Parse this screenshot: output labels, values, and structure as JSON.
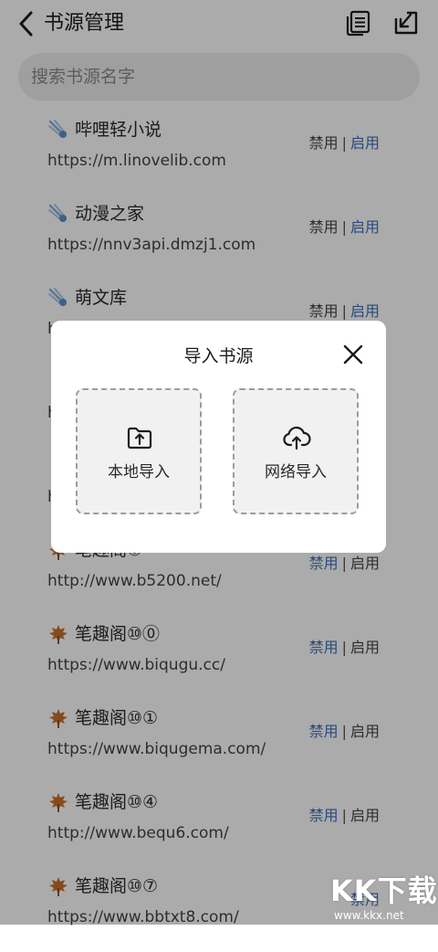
{
  "header": {
    "title": "书源管理",
    "back_icon": "chevron-left-icon",
    "list_icon": "list-icon",
    "export_icon": "arrow-down-left-icon"
  },
  "search": {
    "placeholder": "搜索书源名字"
  },
  "sources": [
    {
      "name": "哔哩轻小说",
      "url": "https://m.linovelib.com",
      "emoji": "comet-icon",
      "disable": "禁用",
      "sep": "|",
      "enable": "启用",
      "enabled": true
    },
    {
      "name": "动漫之家",
      "url": "https://nnv3api.dmzj1.com",
      "emoji": "comet-icon",
      "disable": "禁用",
      "sep": "|",
      "enable": "启用",
      "enabled": true
    },
    {
      "name": "萌文库",
      "url": "h",
      "emoji": "comet-icon",
      "disable": "禁用",
      "sep": "|",
      "enable": "启用",
      "enabled": true
    },
    {
      "name": "",
      "url": "h",
      "emoji": "",
      "disable": "",
      "sep": "",
      "enable": "",
      "enabled": true
    },
    {
      "name": "",
      "url": "h",
      "emoji": "",
      "disable": "",
      "sep": "",
      "enable": "",
      "enabled": true
    },
    {
      "name": "笔趣阁⑥",
      "url": "http://www.b5200.net/",
      "emoji": "leaf-icon",
      "disable": "禁用",
      "sep": "|",
      "enable": "启用",
      "enabled": false
    },
    {
      "name": "笔趣阁⑩⓪",
      "url": "https://www.biqugu.cc/",
      "emoji": "leaf-icon",
      "disable": "禁用",
      "sep": "|",
      "enable": "启用",
      "enabled": false
    },
    {
      "name": "笔趣阁⑩①",
      "url": "https://www.biqugema.com/",
      "emoji": "leaf-icon",
      "disable": "禁用",
      "sep": "|",
      "enable": "启用",
      "enabled": false
    },
    {
      "name": "笔趣阁⑩④",
      "url": "http://www.bequ6.com/",
      "emoji": "leaf-icon",
      "disable": "禁用",
      "sep": "|",
      "enable": "启用",
      "enabled": false
    },
    {
      "name": "笔趣阁⑩⑦",
      "url": "https://www.bbtxt8.com/",
      "emoji": "leaf-icon",
      "disable": "禁用",
      "sep": "",
      "enable": "",
      "enabled": false
    }
  ],
  "dialog": {
    "title": "导入书源",
    "close_icon": "close-icon",
    "options": [
      {
        "label": "本地导入",
        "icon": "folder-upload-icon"
      },
      {
        "label": "网络导入",
        "icon": "cloud-upload-icon"
      }
    ]
  },
  "watermark": {
    "top": "KK下载",
    "bottom": "www.kkx.net"
  },
  "colors": {
    "link": "#3f6db8",
    "overlay": "rgba(0,0,0,0.33)",
    "search_bg": "#eeeeee"
  }
}
